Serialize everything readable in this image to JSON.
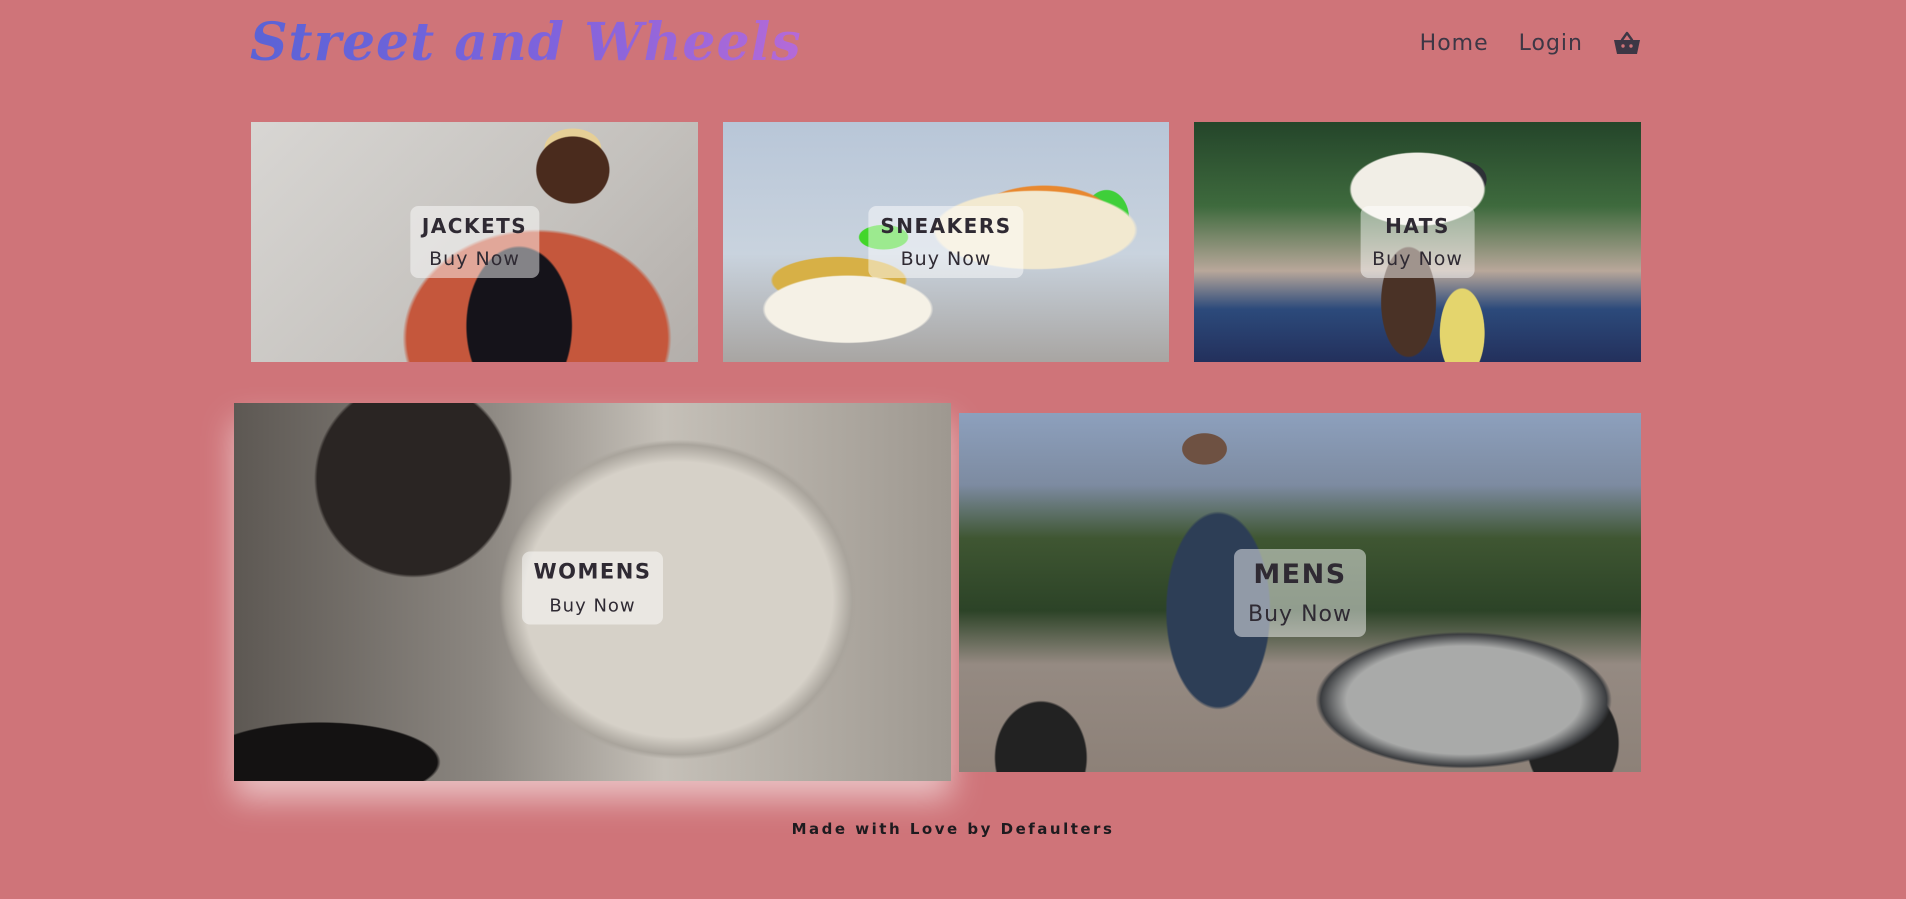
{
  "brand": {
    "logo_text": "Street and Wheels"
  },
  "nav": {
    "home_label": "Home",
    "login_label": "Login",
    "cart_icon": "shopping-basket-icon"
  },
  "categories": {
    "jackets": {
      "title": "JACKETS",
      "cta": "Buy Now"
    },
    "sneakers": {
      "title": "SNEAKERS",
      "cta": "Buy Now"
    },
    "hats": {
      "title": "HATS",
      "cta": "Buy Now"
    },
    "womens": {
      "title": "WOMENS",
      "cta": "Buy Now"
    },
    "mens": {
      "title": "MENS",
      "cta": "Buy Now"
    }
  },
  "footer": {
    "text": "Made with Love by Defaulters"
  },
  "colors": {
    "background": "#cf7479",
    "logo_gradient_start": "#5a63d6",
    "logo_gradient_end": "#b56ad8",
    "nav_text": "#3d3745"
  }
}
